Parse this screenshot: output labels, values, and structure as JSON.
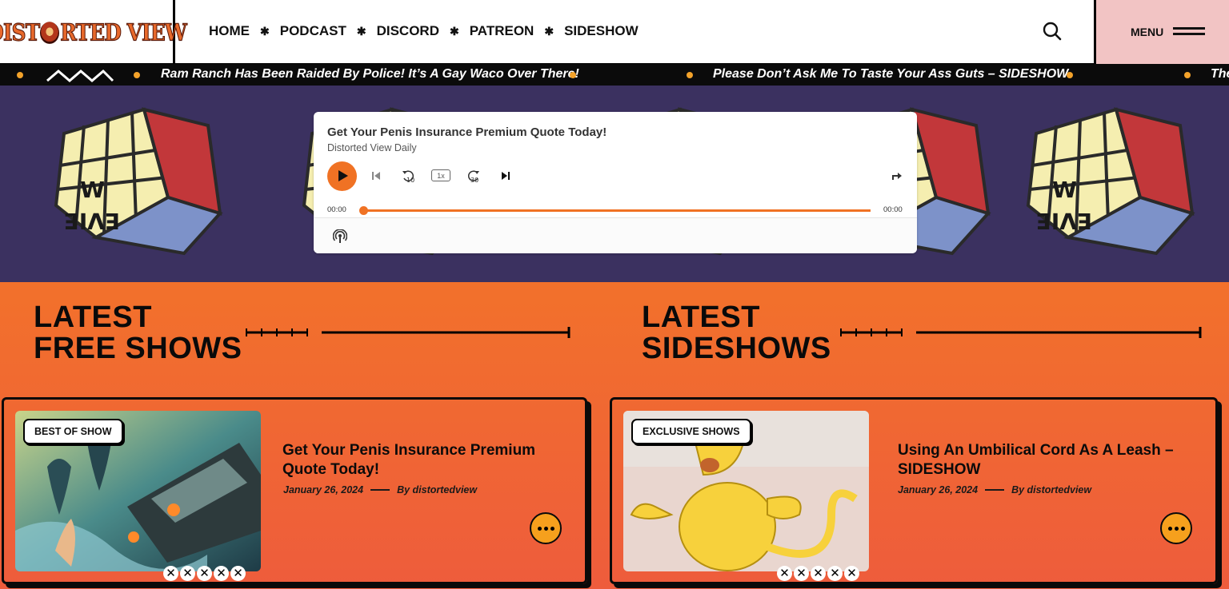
{
  "header": {
    "logo_text": "DISTORTED VIEW",
    "nav": [
      "HOME",
      "PODCAST",
      "DISCORD",
      "PATREON",
      "SIDESHOW"
    ],
    "nav_separator": "✱",
    "menu_label": "MENU"
  },
  "ticker": {
    "items": [
      "Ram Ranch Has Been Raided By Police! It’s A Gay Waco Over There!",
      "Please Don’t Ask Me To Taste Your Ass Guts – SIDESHOW",
      "The"
    ]
  },
  "player": {
    "title": "Get Your Penis Insurance Premium Quote Today!",
    "show": "Distorted View Daily",
    "rewind_label": "10",
    "forward_label": "30",
    "speed": "1x",
    "current_time": "00:00",
    "duration": "00:00",
    "progress": 0
  },
  "sections": [
    {
      "title_line1": "LATEST",
      "title_line2": "FREE SHOWS",
      "card": {
        "badge": "BEST OF SHOW",
        "title": "Get Your Penis Insurance Premium Quote Today!",
        "date": "January 26, 2024",
        "author": "By distortedview",
        "rating_glyph": "✕"
      }
    },
    {
      "title_line1": "LATEST",
      "title_line2": "SIDESHOWS",
      "card": {
        "badge": "EXCLUSIVE SHOWS",
        "title": "Using An Umbilical Cord As A Leash – SIDESHOW",
        "date": "January 26, 2024",
        "author": "By distortedview",
        "rating_glyph": "✕"
      }
    }
  ],
  "colors": {
    "accent_orange": "#f07224",
    "menu_pink": "#f2c4c4",
    "hero_purple": "#3b3160",
    "ticker_dot": "#f3a22a"
  }
}
